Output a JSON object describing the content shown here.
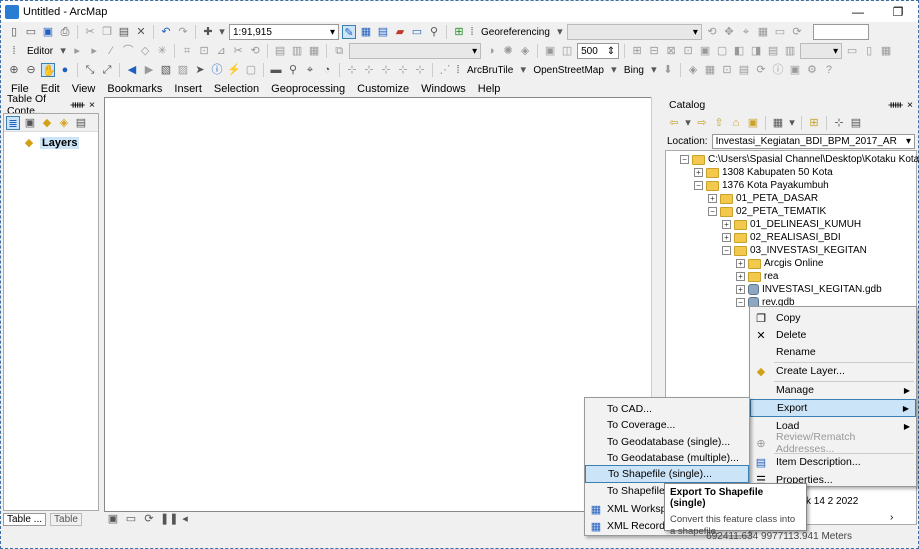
{
  "window": {
    "title": "Untitled - ArcMap",
    "minimize": "—",
    "restore": "❐"
  },
  "toolbar1": {
    "scale": "1:91,915",
    "georef_label": "Georeferencing",
    "georef_value": ""
  },
  "toolbar2": {
    "editor_label": "Editor",
    "size_value": "500"
  },
  "toolbar3": {
    "arcbrutile_label": "ArcBruTile",
    "osm_label": "OpenStreetMap",
    "bing_label": "Bing"
  },
  "menu": [
    "File",
    "Edit",
    "View",
    "Bookmarks",
    "Insert",
    "Selection",
    "Geoprocessing",
    "Customize",
    "Windows",
    "Help"
  ],
  "toc": {
    "title": "Table Of Conte...",
    "pin": "ᚔ",
    "close": "×",
    "layers_label": "Layers",
    "tab_table": "Table ...",
    "tab_table2": "Table"
  },
  "catalog": {
    "title": "Catalog",
    "pin": "ᚔ",
    "close": "×",
    "location_label": "Location:",
    "location_value": "Investasi_Kegiatan_BDI_BPM_2017_AR",
    "tree": [
      {
        "label": "C:\\Users\\Spasial Channel\\Desktop\\Kotaku Kota F",
        "exp": "−",
        "kind": "folder"
      },
      {
        "label": "1308 Kabupaten 50 Kota",
        "exp": "+",
        "kind": "folder"
      },
      {
        "label": "1376 Kota Payakumbuh",
        "exp": "−",
        "kind": "folder"
      },
      {
        "label": "01_PETA_DASAR",
        "exp": "+",
        "kind": "folder"
      },
      {
        "label": "02_PETA_TEMATIK",
        "exp": "−",
        "kind": "folder"
      },
      {
        "label": "01_DELINEASI_KUMUH",
        "exp": "+",
        "kind": "folder"
      },
      {
        "label": "02_REALISASI_BDI",
        "exp": "+",
        "kind": "folder"
      },
      {
        "label": "03_INVESTASI_KEGITAN",
        "exp": "−",
        "kind": "folder"
      },
      {
        "label": "Arcgis Online",
        "exp": "+",
        "kind": "folder"
      },
      {
        "label": "rea",
        "exp": "+",
        "kind": "folder"
      },
      {
        "label": "INVESTASI_KEGITAN.gdb",
        "exp": "+",
        "kind": "gdb"
      },
      {
        "label": "rev.gdb",
        "exp": "−",
        "kind": "gdb"
      }
    ],
    "date_fragment": "k 14 2 2022",
    "date_arrow": "›"
  },
  "context_menu": {
    "items": [
      {
        "label": "Copy",
        "icon": "copy-icon",
        "glyph": "❐"
      },
      {
        "label": "Delete",
        "icon": "delete-icon",
        "glyph": "✕"
      },
      {
        "label": "Rename",
        "icon": "",
        "glyph": ""
      },
      {
        "label": "Create Layer...",
        "icon": "layer-icon",
        "glyph": "◆"
      },
      {
        "label": "Manage",
        "icon": "",
        "glyph": ""
      },
      {
        "label": "Export",
        "icon": "",
        "glyph": ""
      },
      {
        "label": "Load",
        "icon": "",
        "glyph": ""
      },
      {
        "label": "Review/Rematch Addresses...",
        "icon": "rematch-icon",
        "glyph": "⊕"
      },
      {
        "label": "Item Description...",
        "icon": "description-icon",
        "glyph": "▤"
      },
      {
        "label": "Properties...",
        "icon": "properties-icon",
        "glyph": "☰"
      }
    ]
  },
  "export_submenu": {
    "items": [
      "To CAD...",
      "To Coverage...",
      "To Geodatabase (single)...",
      "To Geodatabase (multiple)...",
      "To Shapefile (single)...",
      "To Shapefile (",
      "XML Workspa",
      "XML Recordse"
    ]
  },
  "tooltip": {
    "title": "Export To Shapefile (single)",
    "body": "Convert this feature class into a shapefile."
  },
  "status": {
    "coords": "692411.634  9977113.941 Meters"
  },
  "colors": {
    "highlight": "#cce4f7",
    "highlight_border": "#3c7fb1",
    "folder": "#f2c94c"
  }
}
